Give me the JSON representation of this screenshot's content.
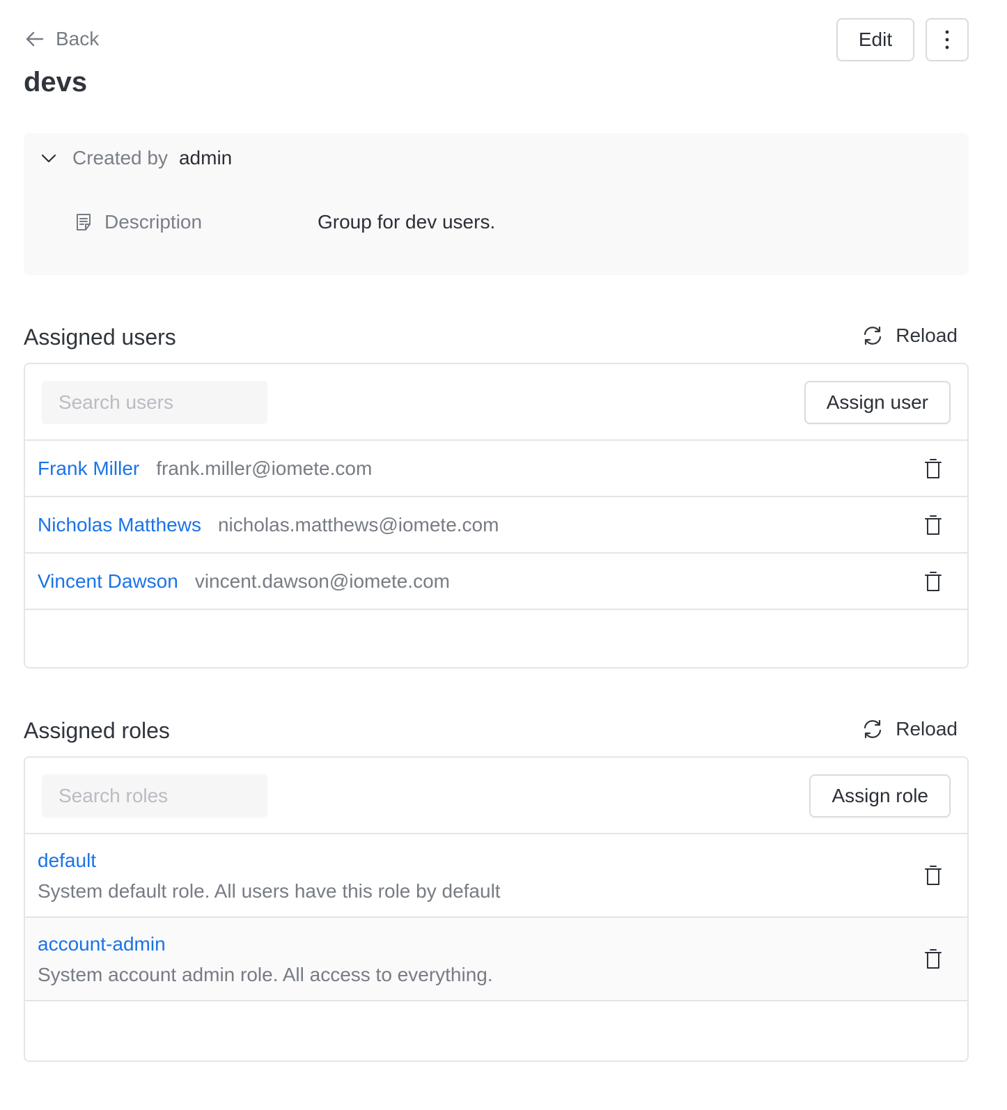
{
  "header": {
    "back_label": "Back",
    "edit_label": "Edit",
    "title": "devs"
  },
  "info": {
    "created_by_label": "Created by",
    "created_by_value": "admin",
    "description_label": "Description",
    "description_value": "Group for dev users."
  },
  "users_section": {
    "title": "Assigned users",
    "reload_label": "Reload",
    "search_placeholder": "Search users",
    "assign_label": "Assign user",
    "users": [
      {
        "name": "Frank Miller",
        "email": "frank.miller@iomete.com"
      },
      {
        "name": "Nicholas Matthews",
        "email": "nicholas.matthews@iomete.com"
      },
      {
        "name": "Vincent Dawson",
        "email": "vincent.dawson@iomete.com"
      }
    ]
  },
  "roles_section": {
    "title": "Assigned roles",
    "reload_label": "Reload",
    "search_placeholder": "Search roles",
    "assign_label": "Assign role",
    "roles": [
      {
        "name": "default",
        "description": "System default role. All users have this role by default"
      },
      {
        "name": "account-admin",
        "description": "System account admin role. All access to everything."
      }
    ]
  },
  "colors": {
    "link": "#1a73e8",
    "muted_text": "#777c84",
    "border": "#e3e5e8",
    "panel_bg": "#f9f9fa"
  },
  "icons": [
    "arrow-left-icon",
    "more-vertical-icon",
    "chevron-down-icon",
    "document-icon",
    "reload-icon",
    "trash-icon"
  ]
}
